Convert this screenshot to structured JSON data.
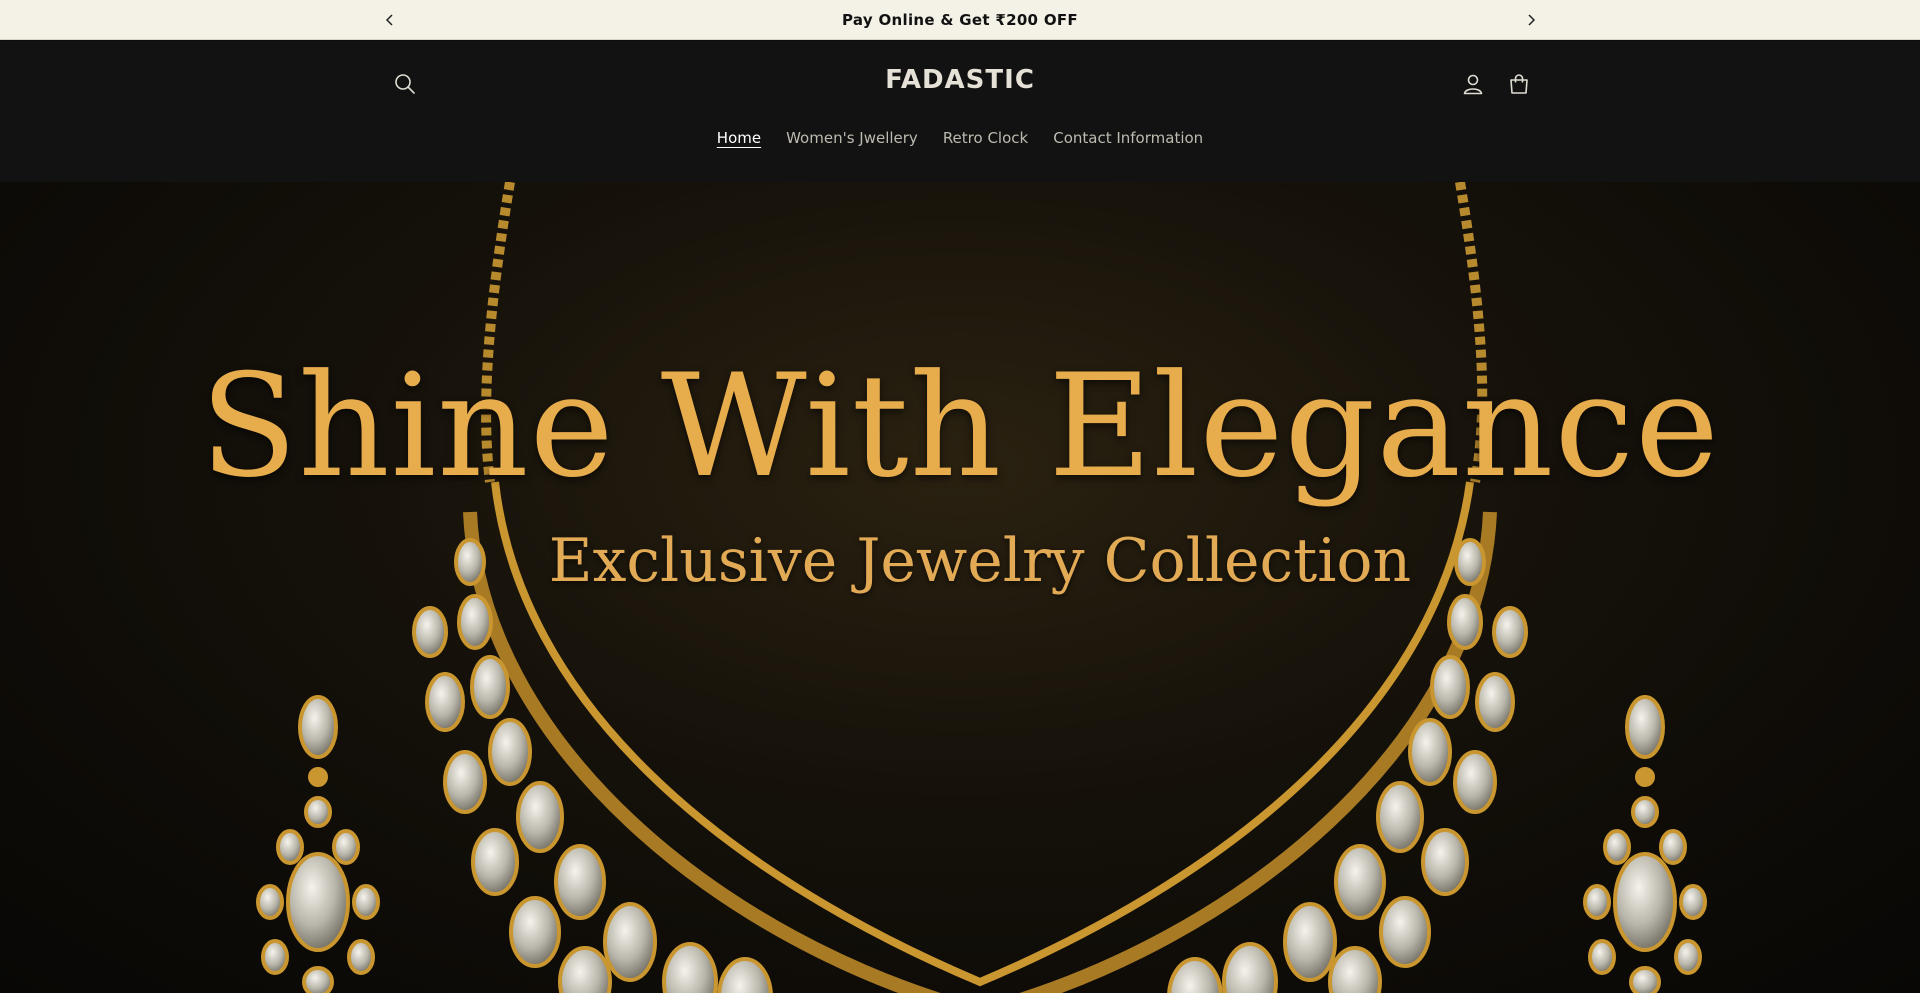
{
  "announcement": {
    "text": "Pay Online & Get ₹200 OFF",
    "prev_icon": "chevron-left-icon",
    "next_icon": "chevron-right-icon"
  },
  "header": {
    "logo": "FADASTIC",
    "search_icon": "search-icon",
    "account_icon": "user-icon",
    "cart_icon": "cart-icon"
  },
  "nav": {
    "items": [
      {
        "label": "Home",
        "active": true
      },
      {
        "label": "Women's Jwellery",
        "active": false
      },
      {
        "label": "Retro Clock",
        "active": false
      },
      {
        "label": "Contact Information",
        "active": false
      }
    ]
  },
  "hero": {
    "title": "Shine With Elegance",
    "subtitle": "Exclusive Jewelry Collection"
  },
  "colors": {
    "announcement_bg": "#f4f1e6",
    "header_bg": "#121212",
    "gold": "#e7ac4c"
  }
}
